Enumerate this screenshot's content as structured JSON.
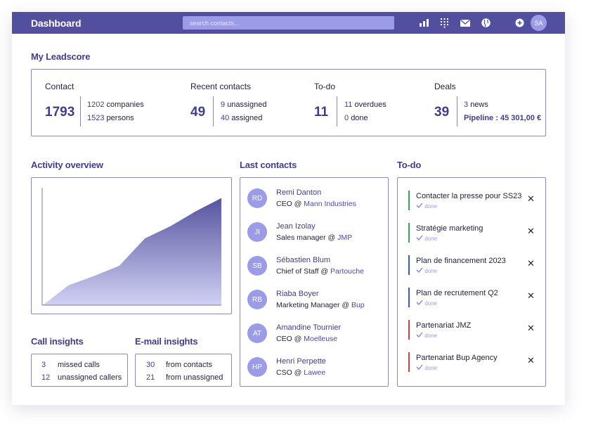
{
  "header": {
    "title": "Dashboard",
    "search_placeholder": "search contacts...",
    "avatar_initials": "SA"
  },
  "leadscore": {
    "title": "My Leadscore",
    "contact": {
      "label": "Contact",
      "total": "1793",
      "companies_count": "1202",
      "companies_label": "companies",
      "persons_count": "1523",
      "persons_label": "persons"
    },
    "recent": {
      "label": "Recent contacts",
      "total": "49",
      "unassigned_count": "9",
      "unassigned_label": "unassigned",
      "assigned_count": "40",
      "assigned_label": "assigned"
    },
    "todo": {
      "label": "To-do",
      "total": "11",
      "overdue_count": "11",
      "overdue_label": "overdues",
      "done_count": "0",
      "done_label": "done"
    },
    "deals": {
      "label": "Deals",
      "total": "39",
      "news_count": "3",
      "news_label": "news",
      "pipeline": "Pipeline : 45 301,00 €"
    }
  },
  "activity": {
    "title": "Activity overview"
  },
  "chart_data": {
    "type": "area",
    "title": "",
    "xlabel": "",
    "ylabel": "",
    "x": [
      0,
      1,
      2,
      3,
      4,
      5,
      6,
      7
    ],
    "values": [
      0,
      0.21,
      0.31,
      0.42,
      0.71,
      0.84,
      1.0,
      1.14
    ],
    "ylim": [
      0,
      1.25
    ],
    "grid": false,
    "colors": {
      "top": "#56549f",
      "bottom": "#d0d0f4"
    }
  },
  "last_contacts": {
    "title": "Last contacts",
    "items": [
      {
        "initials": "RD",
        "name": "Remi Danton",
        "role": "CEO @",
        "company": "Mann Industries"
      },
      {
        "initials": "JI",
        "name": "Jean Izolay",
        "role": "Sales manager @",
        "company": "JMP"
      },
      {
        "initials": "SB",
        "name": "Sébastien Blum",
        "role": "Chief of Staff @",
        "company": "Partouche"
      },
      {
        "initials": "RB",
        "name": "Riaba Boyer",
        "role": "Marketing Manager @",
        "company": "Bup"
      },
      {
        "initials": "AT",
        "name": "Amandine Tournier",
        "role": "CEO @",
        "company": "Moelleuse"
      },
      {
        "initials": "HP",
        "name": "Henri Perpette",
        "role": "CSO @",
        "company": "Lawee"
      }
    ]
  },
  "todo_list": {
    "title": "To-do",
    "items": [
      {
        "title": "Contacter la presse pour SS23",
        "status": "done",
        "color": "#3ea45a"
      },
      {
        "title": "Stratégie marketing",
        "status": "done",
        "color": "#3ea45a"
      },
      {
        "title": "Plan de financement 2023",
        "status": "done",
        "color": "#3a5db0"
      },
      {
        "title": "Plan de recrutement Q2",
        "status": "done",
        "color": "#3a5db0"
      },
      {
        "title": "Partenariat JMZ",
        "status": "done",
        "color": "#c2463d"
      },
      {
        "title": "Partenariat Bup Agency",
        "status": "done",
        "color": "#c2463d"
      }
    ]
  },
  "call_insights": {
    "title": "Call insights",
    "rows": [
      {
        "value": "3",
        "label": "missed calls"
      },
      {
        "value": "12",
        "label": "unassigned callers"
      }
    ]
  },
  "email_insights": {
    "title": "E-mail insights",
    "rows": [
      {
        "value": "30",
        "label": "from contacts"
      },
      {
        "value": "21",
        "label": "from unassigned"
      }
    ]
  },
  "icons": [
    "bar-chart-icon",
    "dial-pad-icon",
    "mail-icon",
    "globe-icon",
    "add-icon"
  ]
}
